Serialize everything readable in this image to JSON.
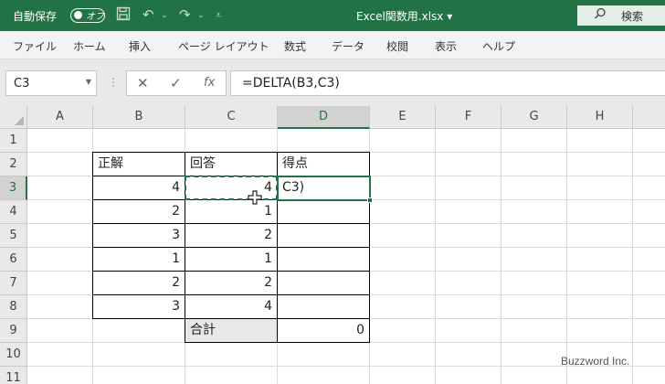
{
  "titlebar": {
    "autosave_label": "自動保存",
    "autosave_toggle": "オフ",
    "filename": "Excel関数用.xlsx ▾",
    "search_label": "検索"
  },
  "ribbon": {
    "tabs": [
      "ファイル",
      "ホーム",
      "挿入",
      "ページ レイアウト",
      "数式",
      "データ",
      "校閲",
      "表示",
      "ヘルプ"
    ]
  },
  "formula_bar": {
    "name_box": "C3",
    "fx_label": "fx",
    "formula": "=DELTA(B3,C3)"
  },
  "columns": [
    "A",
    "B",
    "C",
    "D",
    "E",
    "F",
    "G",
    "H"
  ],
  "rows": [
    "1",
    "2",
    "3",
    "4",
    "5",
    "6",
    "7",
    "8",
    "9",
    "10",
    "11"
  ],
  "table": {
    "headers": [
      "正解",
      "回答",
      "得点"
    ],
    "rows": [
      {
        "b": "4",
        "c": "4",
        "d": "C3)"
      },
      {
        "b": "2",
        "c": "1",
        "d": ""
      },
      {
        "b": "3",
        "c": "2",
        "d": ""
      },
      {
        "b": "1",
        "c": "1",
        "d": ""
      },
      {
        "b": "2",
        "c": "2",
        "d": ""
      },
      {
        "b": "3",
        "c": "4",
        "d": ""
      }
    ],
    "total_label": "合計",
    "total_value": "0"
  },
  "watermark": "Buzzword Inc.",
  "colors": {
    "excel_green": "#217346",
    "header_gray": "#e9e9e9"
  }
}
